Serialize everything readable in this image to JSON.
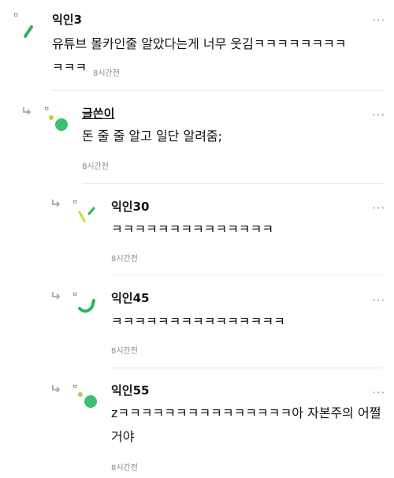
{
  "comments": [
    {
      "author": "익인3",
      "avatar_tag": "ㅁ",
      "text_line1": "유튜브 몰카인줄 알았다는게 너무 웃김ㅋㅋㅋㅋㅋㅋㅋㅋ",
      "text_line2": "ㅋㅋㅋ",
      "time": "8시간전",
      "more": "···"
    },
    {
      "author": "글쓴이",
      "avatar_tag": "ㅁ",
      "text": "돈 줄 줄 알고 일단 알려줌;",
      "time": "8시간전",
      "more": "···"
    },
    {
      "author": "익인30",
      "avatar_tag": "ㅁ",
      "text": "ㅋㅋㅋㅋㅋㅋㅋㅋㅋㅋㅋㅋㅋㅋ",
      "time": "8시간전",
      "more": "···"
    },
    {
      "author": "익인45",
      "avatar_tag": "ㅁ",
      "text": "ㅋㅋㅋㅋㅋㅋㅋㅋㅋㅋㅋㅋㅋㅋㅋ",
      "time": "8시간전",
      "more": "···"
    },
    {
      "author": "익인55",
      "avatar_tag": "ㅁ",
      "text_line1": "zㅋㅋㅋㅋㅋㅋㅋㅋㅋㅋㅋㅋㅋㅋㅋ아 자본주의 어쩔",
      "text_line2": "거야",
      "time": "8시간전",
      "more": "···"
    }
  ],
  "colors": {
    "accent_green": "#2db55d",
    "accent_lime": "#a8d64a",
    "text": "#111111",
    "muted": "#8a8a8a",
    "divider": "#e9e9e9"
  }
}
